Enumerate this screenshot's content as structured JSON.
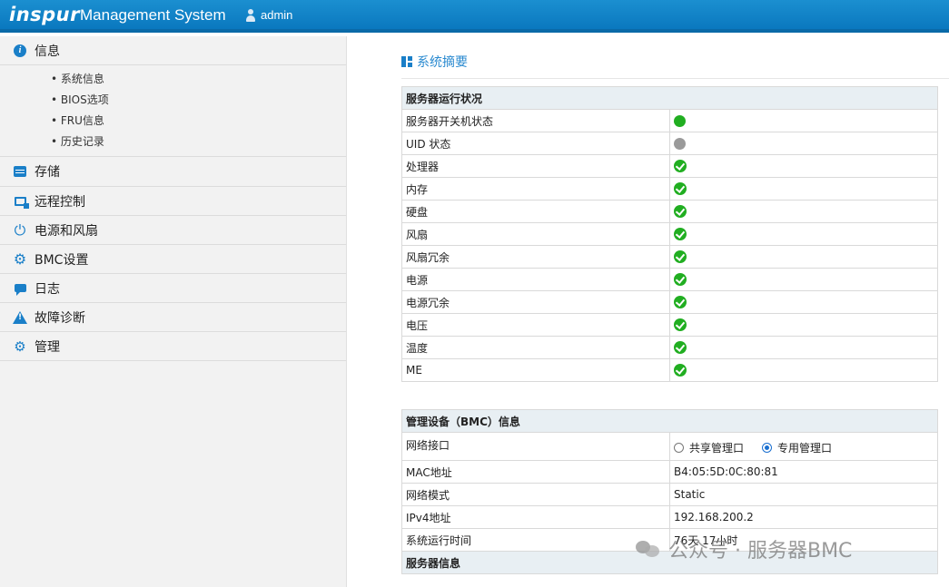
{
  "header": {
    "brand": "inspur",
    "title": "Management System",
    "user": "admin"
  },
  "sidebar": {
    "items": [
      {
        "label": "信息",
        "icon": "info-icon",
        "sub": [
          "系统信息",
          "BIOS选项",
          "FRU信息",
          "历史记录"
        ]
      },
      {
        "label": "存储",
        "icon": "storage-icon"
      },
      {
        "label": "远程控制",
        "icon": "remote-control-icon"
      },
      {
        "label": "电源和风扇",
        "icon": "power-icon"
      },
      {
        "label": "BMC设置",
        "icon": "gear-icon"
      },
      {
        "label": "日志",
        "icon": "chat-icon"
      },
      {
        "label": "故障诊断",
        "icon": "warning-icon"
      },
      {
        "label": "管理",
        "icon": "gears-icon"
      }
    ]
  },
  "main": {
    "section_title": "系统摘要",
    "server_status": {
      "heading": "服务器运行状况",
      "rows": [
        {
          "label": "服务器开关机状态",
          "status": "on"
        },
        {
          "label": "UID 状态",
          "status": "off"
        },
        {
          "label": "处理器",
          "status": "ok"
        },
        {
          "label": "内存",
          "status": "ok"
        },
        {
          "label": "硬盘",
          "status": "ok"
        },
        {
          "label": "风扇",
          "status": "ok"
        },
        {
          "label": "风扇冗余",
          "status": "ok"
        },
        {
          "label": "电源",
          "status": "ok"
        },
        {
          "label": "电源冗余",
          "status": "ok"
        },
        {
          "label": "电压",
          "status": "ok"
        },
        {
          "label": "温度",
          "status": "ok"
        },
        {
          "label": "ME",
          "status": "ok"
        }
      ]
    },
    "bmc_info": {
      "heading": "管理设备（BMC）信息",
      "network_interface_label": "网络接口",
      "radio_shared": "共享管理口",
      "radio_dedicated": "专用管理口",
      "radio_selected": "dedicated",
      "rows": [
        {
          "label": "MAC地址",
          "value": "B4:05:5D:0C:80:81"
        },
        {
          "label": "网络模式",
          "value": "Static"
        },
        {
          "label": "IPv4地址",
          "value": "192.168.200.2"
        },
        {
          "label": "系统运行时间",
          "value": "76天 17小时"
        }
      ]
    },
    "server_info": {
      "heading": "服务器信息"
    }
  },
  "watermark": "公众号 · 服务器BMC",
  "colors": {
    "header": "#0a78bf",
    "accent": "#1a7fc8",
    "ok_green": "#21ae21",
    "off_gray": "#9a9a9a"
  }
}
